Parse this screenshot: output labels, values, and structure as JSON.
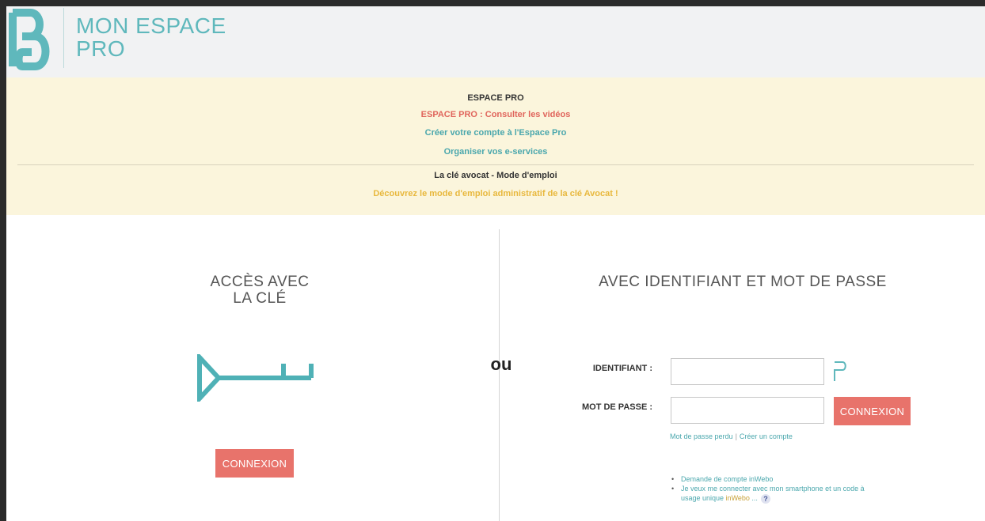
{
  "header": {
    "brand_line1": "MON ESPACE",
    "brand_line2": "PRO",
    "logo_icon": "logo-b-icon"
  },
  "banner": {
    "title": "ESPACE PRO",
    "videos_link": "ESPACE PRO : Consulter les vidéos",
    "create_link": "Créer votre compte à l'Espace Pro",
    "eservices_link": "Organiser vos e-services",
    "key_title": "La clé avocat - Mode d'emploi",
    "key_discover": "Découvrez le mode d'emploi administratif de la clé Avocat !"
  },
  "left": {
    "title_line1": "ACCÈS AVEC",
    "title_line2": "LA CLÉ",
    "key_icon": "usb-key-icon",
    "button": "CONNEXION"
  },
  "separator": "ou",
  "right": {
    "title": "AVEC IDENTIFIANT ET MOT DE PASSE",
    "id_label": "IDENTIFIANT :",
    "id_value": "",
    "pw_label": "MOT DE PASSE :",
    "pw_value": "",
    "help_icon": "help-question-icon",
    "button": "CONNEXION",
    "lost_password": "Mot de passe perdu",
    "create_account": "Créer un compte",
    "bullet1": "Demande de compte inWebo",
    "bullet2_a": "Je veux me connecter avec mon smartphone et un code à usage unique ",
    "bullet2_b": "inWebo",
    "bullet2_c": " ...",
    "info_glyph": "?"
  },
  "colors": {
    "accent_teal": "#5fb8bc",
    "link_teal": "#4aa7ad",
    "button_coral": "#e8736b",
    "banner_bg": "#fbf5dc",
    "link_red": "#e0655c",
    "link_gold": "#e8b83d"
  }
}
